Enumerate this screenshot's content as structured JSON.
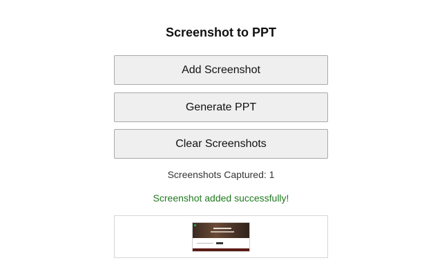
{
  "header": {
    "title": "Screenshot to PPT"
  },
  "actions": {
    "add_label": "Add Screenshot",
    "generate_label": "Generate PPT",
    "clear_label": "Clear Screenshots"
  },
  "status": {
    "count_text": "Screenshots Captured: 1",
    "message": "Screenshot added successfully!",
    "message_color": "#1f7a1f"
  },
  "colors": {
    "button_bg": "#efefef",
    "button_border": "#a8a8a8"
  }
}
